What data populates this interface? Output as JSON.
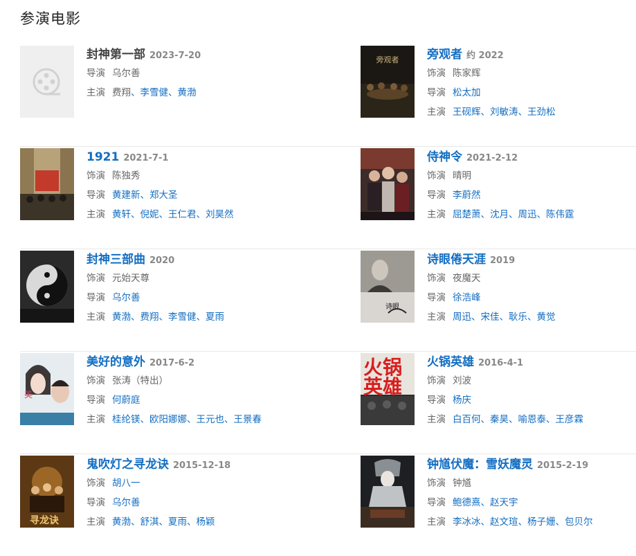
{
  "section_title": "参演电影",
  "films": [
    {
      "title": "封神第一部",
      "title_link": false,
      "date": "2023-7-20",
      "poster": "placeholder-film-reel",
      "lines": [
        {
          "label": "导演",
          "names": [
            "乌尔善"
          ],
          "link": false
        },
        {
          "label": "主演",
          "names": [
            "费翔",
            "李雪健",
            "黄渤"
          ],
          "link": true,
          "first_plain": true
        }
      ]
    },
    {
      "title": "旁观者",
      "title_link": true,
      "date": "约 2022",
      "poster": "dark-banquet",
      "lines": [
        {
          "label": "饰演",
          "names": [
            "陈家辉"
          ],
          "link": false
        },
        {
          "label": "导演",
          "names": [
            "松太加"
          ],
          "link": true
        },
        {
          "label": "主演",
          "names": [
            "王砚辉",
            "刘敏涛",
            "王劲松"
          ],
          "link": true
        }
      ]
    },
    {
      "title": "1921",
      "title_link": true,
      "date": "2021-7-1",
      "poster": "street-crowd",
      "lines": [
        {
          "label": "饰演",
          "names": [
            "陈独秀"
          ],
          "link": false
        },
        {
          "label": "导演",
          "names": [
            "黄建新",
            "郑大圣"
          ],
          "link": true
        },
        {
          "label": "主演",
          "names": [
            "黄轩",
            "倪妮",
            "王仁君",
            "刘昊然"
          ],
          "link": true
        }
      ]
    },
    {
      "title": "侍神令",
      "title_link": true,
      "date": "2021-2-12",
      "poster": "fantasy-ensemble",
      "lines": [
        {
          "label": "饰演",
          "names": [
            "晴明"
          ],
          "link": false
        },
        {
          "label": "导演",
          "names": [
            "李蔚然"
          ],
          "link": true
        },
        {
          "label": "主演",
          "names": [
            "屈楚萧",
            "沈月",
            "周迅",
            "陈伟霆"
          ],
          "link": true
        }
      ]
    },
    {
      "title": "封神三部曲",
      "title_link": true,
      "date": "2020",
      "poster": "ink-taiji",
      "lines": [
        {
          "label": "饰演",
          "names": [
            "元始天尊"
          ],
          "link": false
        },
        {
          "label": "导演",
          "names": [
            "乌尔善"
          ],
          "link": true
        },
        {
          "label": "主演",
          "names": [
            "黄渤",
            "费翔",
            "李雪健",
            "夏雨"
          ],
          "link": true
        }
      ]
    },
    {
      "title": "诗眼倦天涯",
      "title_link": true,
      "date": "2019",
      "poster": "monochrome-portrait",
      "lines": [
        {
          "label": "饰演",
          "names": [
            "夜魔天"
          ],
          "link": false
        },
        {
          "label": "导演",
          "names": [
            "徐浩峰"
          ],
          "link": true
        },
        {
          "label": "主演",
          "names": [
            "周迅",
            "宋佳",
            "耿乐",
            "黄觉"
          ],
          "link": true
        }
      ]
    },
    {
      "title": "美好的意外",
      "title_link": true,
      "date": "2017-6-2",
      "poster": "couple-portrait",
      "lines": [
        {
          "label": "饰演",
          "names": [
            "张涛（特出）"
          ],
          "link": false
        },
        {
          "label": "导演",
          "names": [
            "何蔚庭"
          ],
          "link": true
        },
        {
          "label": "主演",
          "names": [
            "桂纶镁",
            "欧阳娜娜",
            "王元也",
            "王景春"
          ],
          "link": true
        }
      ]
    },
    {
      "title": "火锅英雄",
      "title_link": true,
      "date": "2016-4-1",
      "poster": "red-calligraphy",
      "lines": [
        {
          "label": "饰演",
          "names": [
            "刘波"
          ],
          "link": false
        },
        {
          "label": "导演",
          "names": [
            "杨庆"
          ],
          "link": true
        },
        {
          "label": "主演",
          "names": [
            "白百何",
            "秦昊",
            "喻恩泰",
            "王彦霖"
          ],
          "link": true
        }
      ]
    },
    {
      "title": "鬼吹灯之寻龙诀",
      "title_link": true,
      "date": "2015-12-18",
      "poster": "golden-adventure",
      "lines": [
        {
          "label": "饰演",
          "names": [
            "胡八一"
          ],
          "link": true
        },
        {
          "label": "导演",
          "names": [
            "乌尔善"
          ],
          "link": true
        },
        {
          "label": "主演",
          "names": [
            "黄渤",
            "舒淇",
            "夏雨",
            "杨颖"
          ],
          "link": true
        }
      ]
    },
    {
      "title": "钟馗伏魔：雪妖魔灵",
      "title_link": true,
      "date": "2015-2-19",
      "poster": "snow-demon",
      "lines": [
        {
          "label": "饰演",
          "names": [
            "钟馗"
          ],
          "link": false
        },
        {
          "label": "导演",
          "names": [
            "鲍德熹",
            "赵天宇"
          ],
          "link": true
        },
        {
          "label": "主演",
          "names": [
            "李冰冰",
            "赵文瑄",
            "杨子姗",
            "包贝尔"
          ],
          "link": true
        }
      ]
    }
  ]
}
